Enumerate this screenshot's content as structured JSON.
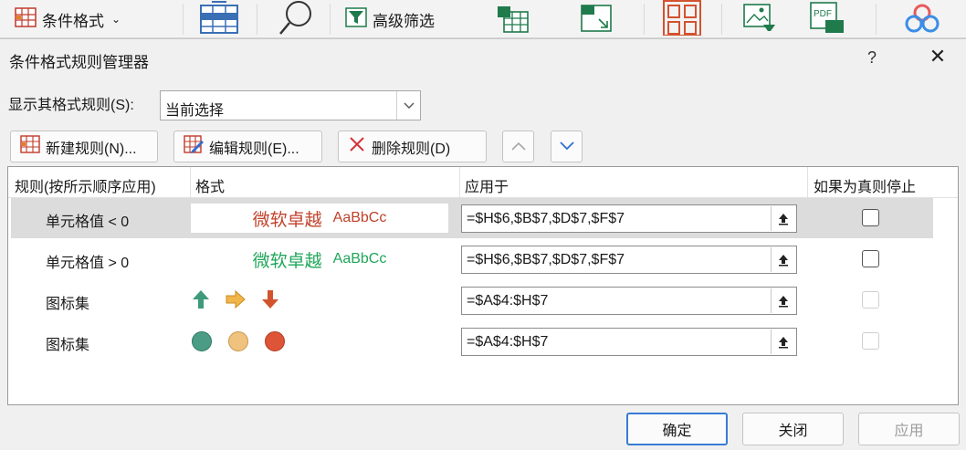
{
  "ribbon": {
    "conditional_format_label": "条件格式",
    "advanced_filter_label": "高级筛选"
  },
  "dialog": {
    "title": "条件格式规则管理器",
    "help_label": "?",
    "close_label": "✕",
    "show_rules_label": "显示其格式规则(S):",
    "show_rules_value": "当前选择",
    "buttons": {
      "new_rule": "新建规则(N)...",
      "edit_rule": "编辑规则(E)...",
      "delete_rule": "删除规则(D)"
    },
    "columns": {
      "rule": "规则(按所示顺序应用)",
      "format": "格式",
      "applies_to": "应用于",
      "stop_if_true": "如果为真则停止"
    },
    "rules": [
      {
        "name": "单元格值 < 0",
        "preview_big": "微软卓越",
        "preview_small": "AaBbCc",
        "preview_color": "#c0412b",
        "applies_to": "=$H$6,$B$7,$D$7,$F$7",
        "stop_checked": false,
        "stop_enabled": true
      },
      {
        "name": "单元格值 > 0",
        "preview_big": "微软卓越",
        "preview_small": "AaBbCc",
        "preview_color": "#1fa65a",
        "applies_to": "=$H$6,$B$7,$D$7,$F$7",
        "stop_checked": false,
        "stop_enabled": true
      },
      {
        "name": "图标集",
        "icons": [
          "arrow-up-icon",
          "arrow-right-icon",
          "arrow-down-icon"
        ],
        "applies_to": "=$A$4:$H$7",
        "stop_checked": false,
        "stop_enabled": false
      },
      {
        "name": "图标集",
        "icons": [
          "circle-green-icon",
          "circle-yellow-icon",
          "circle-red-icon"
        ],
        "applies_to": "=$A$4:$H$7",
        "stop_checked": false,
        "stop_enabled": false
      }
    ],
    "footer": {
      "ok": "确定",
      "close": "关闭",
      "apply": "应用"
    }
  }
}
